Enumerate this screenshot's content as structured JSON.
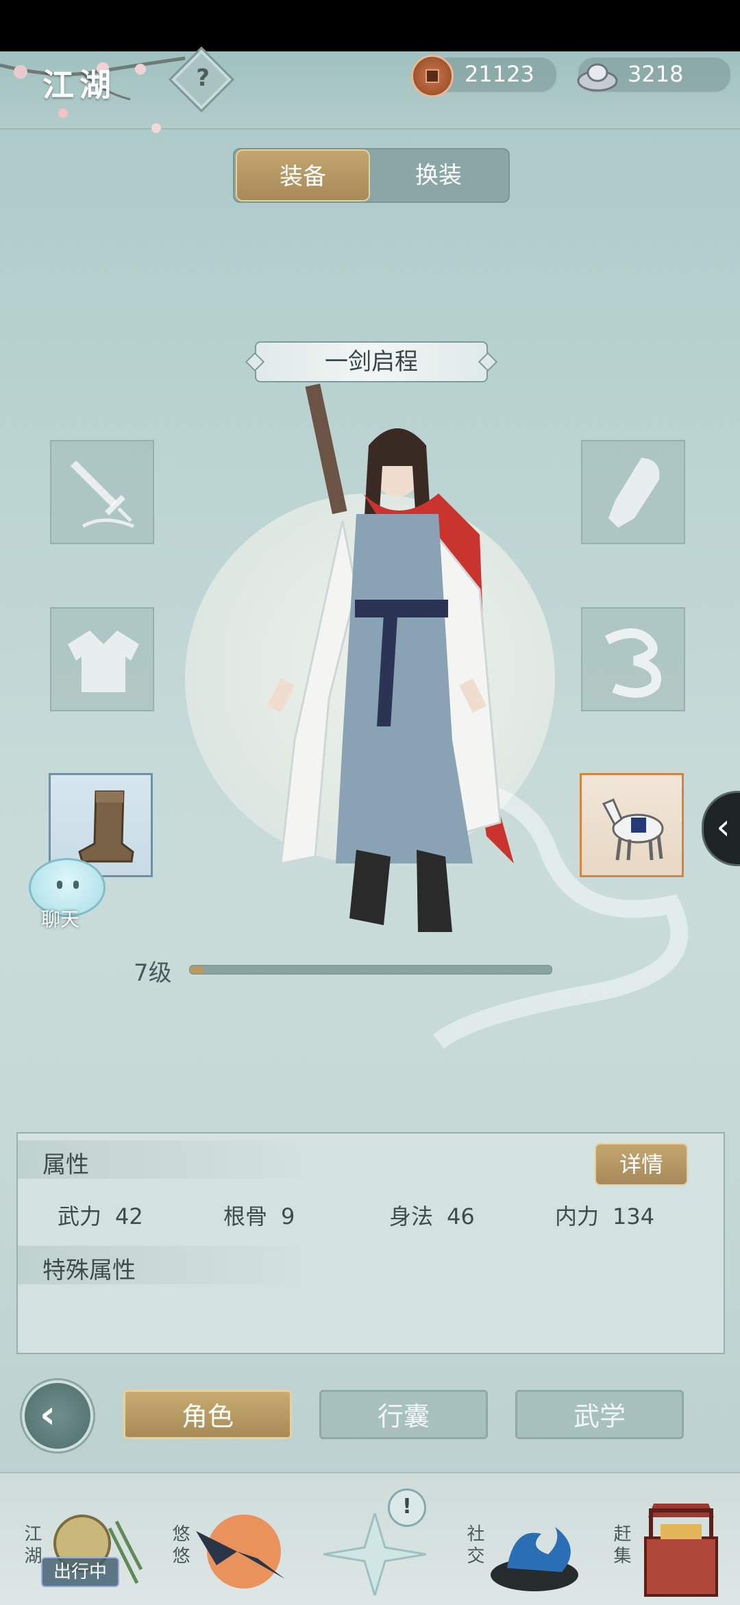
{
  "header": {
    "title": "江湖",
    "help_icon": "question-mark",
    "currencies": [
      {
        "name": "copper-coin",
        "amount": "21123"
      },
      {
        "name": "silver-ingot",
        "amount": "3218"
      }
    ]
  },
  "tabs": {
    "equip": "装备",
    "outfit": "换装",
    "active": "装备"
  },
  "character": {
    "title": "一剑启程",
    "level_text": "7级",
    "exp_fraction": 0.04
  },
  "slots": {
    "left": [
      "sword-icon",
      "robe-icon",
      "boots-icon"
    ],
    "right": [
      "bracer-icon",
      "cloud-charm-icon",
      "horse-icon"
    ]
  },
  "chat": {
    "label": "聊天"
  },
  "attributes": {
    "heading": "属性",
    "detail_button": "详情",
    "stats": [
      {
        "label": "武力",
        "value": "42"
      },
      {
        "label": "根骨",
        "value": "9"
      },
      {
        "label": "身法",
        "value": "46"
      },
      {
        "label": "内力",
        "value": "134"
      }
    ],
    "special_heading": "特殊属性"
  },
  "bottom_tabs": {
    "items": [
      "角色",
      "行囊",
      "武学"
    ],
    "active": "角色"
  },
  "nav": {
    "items": [
      {
        "label": "江湖",
        "icon": "jianghu-icon"
      },
      {
        "label": "悠悠",
        "icon": "swallow-sun-icon"
      },
      {
        "label": "",
        "icon": "compass-star-icon"
      },
      {
        "label": "社交",
        "icon": "wave-icon"
      },
      {
        "label": "赶集",
        "icon": "market-basket-icon"
      }
    ],
    "travel_tag": "出行中",
    "notification": "!"
  },
  "colors": {
    "gold_accent": "#b59a63",
    "teal_bg": "#bcd4d2",
    "status_bar": "#000000"
  }
}
